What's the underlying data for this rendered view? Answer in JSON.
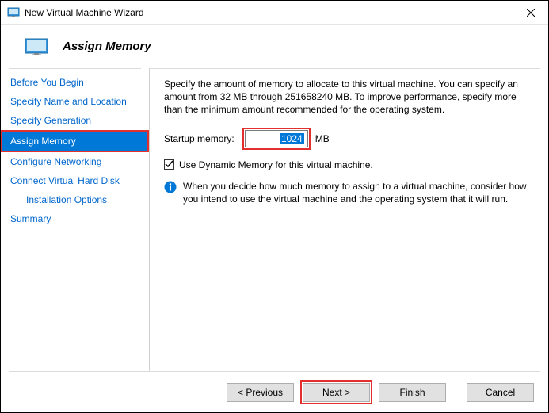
{
  "window": {
    "title": "New Virtual Machine Wizard"
  },
  "header": {
    "title": "Assign Memory"
  },
  "sidebar": {
    "items": [
      {
        "label": "Before You Begin"
      },
      {
        "label": "Specify Name and Location"
      },
      {
        "label": "Specify Generation"
      },
      {
        "label": "Assign Memory"
      },
      {
        "label": "Configure Networking"
      },
      {
        "label": "Connect Virtual Hard Disk"
      },
      {
        "label": "Installation Options"
      },
      {
        "label": "Summary"
      }
    ]
  },
  "content": {
    "intro": "Specify the amount of memory to allocate to this virtual machine. You can specify an amount from 32 MB through 251658240 MB. To improve performance, specify more than the minimum amount recommended for the operating system.",
    "startup_label": "Startup memory:",
    "startup_value": "1024",
    "startup_unit": "MB",
    "dynamic_label": "Use Dynamic Memory for this virtual machine.",
    "info": "When you decide how much memory to assign to a virtual machine, consider how you intend to use the virtual machine and the operating system that it will run."
  },
  "footer": {
    "previous": "< Previous",
    "next": "Next >",
    "finish": "Finish",
    "cancel": "Cancel"
  }
}
